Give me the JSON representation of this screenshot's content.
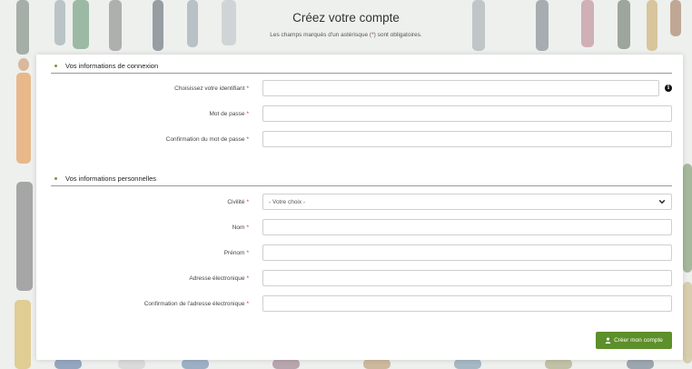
{
  "header": {
    "title": "Créez votre compte",
    "subtitle_before": "Les champs marqués d'un astérisque (",
    "subtitle_asterisk": "*",
    "subtitle_after": ") sont obligatoires."
  },
  "sections": [
    {
      "title": "Vos informations de connexion",
      "fields": [
        {
          "label": "Choisissez votre identifiant",
          "required": "*",
          "value": "",
          "info_icon": "info-icon"
        },
        {
          "label": "Mot de passe",
          "required": "*",
          "value": ""
        },
        {
          "label": "Confirmation du mot de passe",
          "required": "*",
          "value": ""
        }
      ]
    },
    {
      "title": "Vos informations personnelles",
      "fields": [
        {
          "label": "Civilité",
          "required": "*",
          "type": "select",
          "selected": "- Votre choix -"
        },
        {
          "label": "Nom",
          "required": "*",
          "value": ""
        },
        {
          "label": "Prénom",
          "required": "*",
          "value": ""
        },
        {
          "label": "Adresse électronique",
          "required": "*",
          "value": ""
        },
        {
          "label": "Confirmation de l'adresse électronique",
          "required": "*",
          "value": ""
        }
      ]
    }
  ],
  "submit": {
    "label": "Créer mon compte",
    "icon": "user-icon"
  },
  "colors": {
    "accent": "#5d8f2b",
    "required": "#c0392b",
    "bullet": "#7a9a3a"
  }
}
